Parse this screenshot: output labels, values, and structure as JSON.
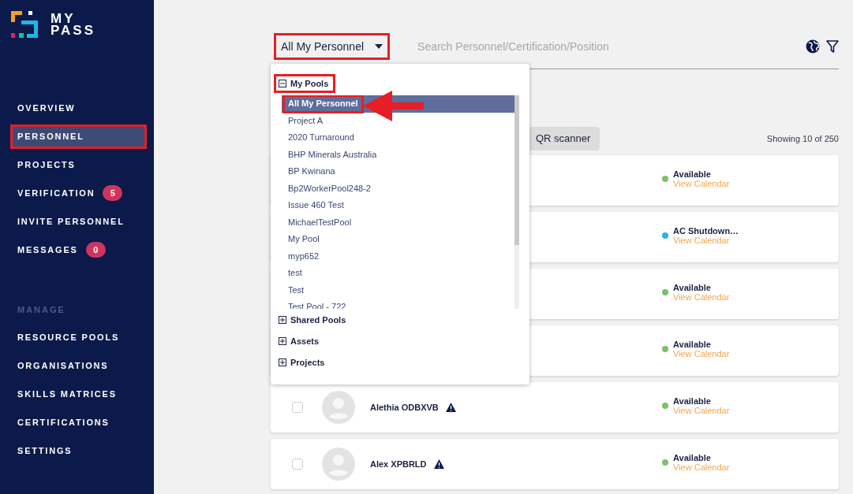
{
  "brand": {
    "line_1": "MY",
    "line_2": "PASS"
  },
  "sidebar": {
    "items": [
      {
        "label": "OVERVIEW",
        "selected": false,
        "highlighted": false
      },
      {
        "label": "PERSONNEL",
        "selected": true,
        "highlighted": true
      },
      {
        "label": "PROJECTS",
        "selected": false,
        "highlighted": false
      },
      {
        "label": "VERIFICATION",
        "selected": false,
        "highlighted": false,
        "badge": "5"
      },
      {
        "label": "INVITE PERSONNEL",
        "selected": false,
        "highlighted": false
      },
      {
        "label": "MESSAGES",
        "selected": false,
        "highlighted": false,
        "badge": "0"
      }
    ],
    "section_heading": "MANAGE",
    "manage_items": [
      {
        "label": "RESOURCE POOLS",
        "selected": false,
        "highlighted": false
      },
      {
        "label": "ORGANISATIONS",
        "selected": false,
        "highlighted": false
      },
      {
        "label": "SKILLS MATRICES",
        "selected": false,
        "highlighted": false
      },
      {
        "label": "CERTIFICATIONS",
        "selected": false,
        "highlighted": false
      },
      {
        "label": "SETTINGS",
        "selected": false,
        "highlighted": false
      }
    ]
  },
  "pool_select": {
    "value": "All My Personnel",
    "highlighted": true,
    "expanded": true
  },
  "search": {
    "placeholder": "Search Personnel/Certification/Position"
  },
  "dropdown": {
    "groups": [
      {
        "label": "My Pools",
        "expanded": true,
        "highlighted": true,
        "items": [
          {
            "label": "All My Personnel",
            "selected": true,
            "highlighted": true
          },
          {
            "label": "Project A",
            "selected": false,
            "highlighted": false
          },
          {
            "label": "2020 Turnaround",
            "selected": false,
            "highlighted": false
          },
          {
            "label": "BHP Minerals Australia",
            "selected": false,
            "highlighted": false
          },
          {
            "label": "BP Kwinana",
            "selected": false,
            "highlighted": false
          },
          {
            "label": "Bp2WorkerPool248-2",
            "selected": false,
            "highlighted": false
          },
          {
            "label": "Issue 460 Test",
            "selected": false,
            "highlighted": false
          },
          {
            "label": "MichaelTestPool",
            "selected": false,
            "highlighted": false
          },
          {
            "label": "My Pool",
            "selected": false,
            "highlighted": false
          },
          {
            "label": "myp652",
            "selected": false,
            "highlighted": false
          },
          {
            "label": "test",
            "selected": false,
            "highlighted": false
          },
          {
            "label": "Test",
            "selected": false,
            "highlighted": false
          },
          {
            "label": "Test Pool - 722",
            "selected": false,
            "highlighted": false
          }
        ]
      },
      {
        "label": "Shared Pools",
        "expanded": false,
        "highlighted": false
      },
      {
        "label": "Assets",
        "expanded": false,
        "highlighted": false
      },
      {
        "label": "Projects",
        "expanded": false,
        "highlighted": false
      }
    ]
  },
  "qr_button": "QR scanner",
  "showing": "Showing 10 of 250",
  "rows": [
    {
      "status": "Available",
      "color": "#7cbf6e",
      "link": "View Calendar"
    },
    {
      "status": "AC Shutdown…",
      "color": "#2bb3e0",
      "link": "View Calendar"
    },
    {
      "status": "Available",
      "color": "#7cbf6e",
      "link": "View Calendar"
    },
    {
      "status": "Available",
      "color": "#7cbf6e",
      "link": "View Calendar"
    },
    {
      "name": "Alethia ODBXVB",
      "checked": false,
      "warning": true,
      "status": "Available",
      "color": "#7cbf6e",
      "link": "View Calendar"
    },
    {
      "name": "Alex XPBRLD",
      "checked": false,
      "warning": true,
      "status": "Available",
      "color": "#7cbf6e",
      "link": "View Calendar"
    }
  ]
}
